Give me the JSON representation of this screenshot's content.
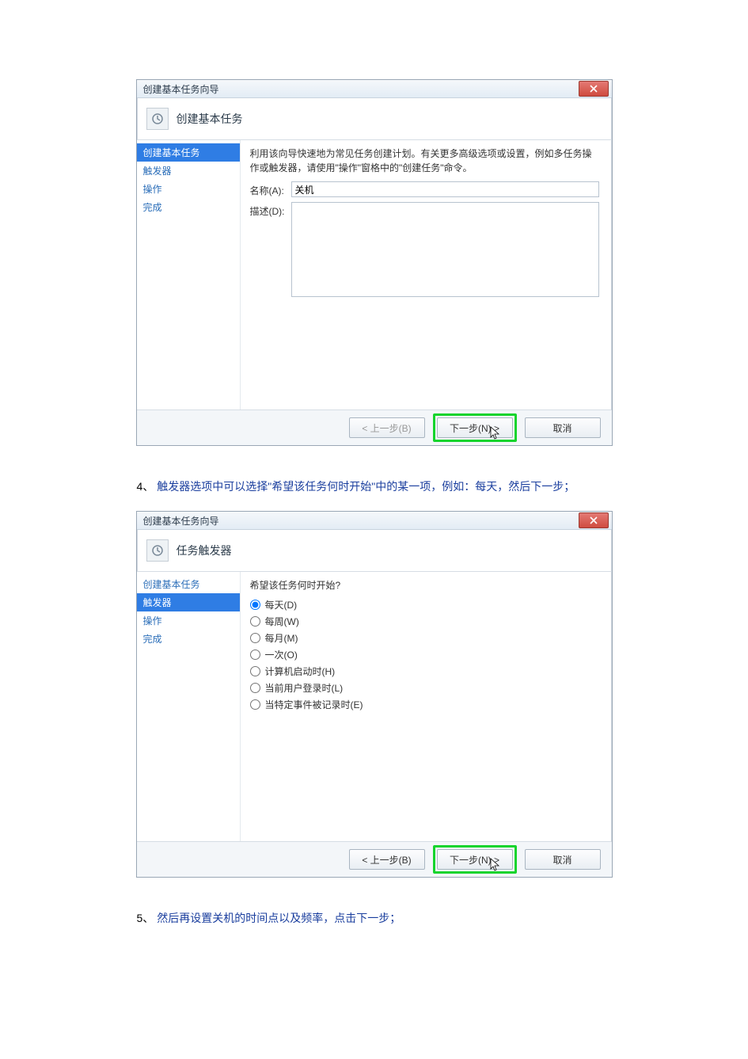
{
  "dialog1": {
    "title": "创建基本任务向导",
    "header": "创建基本任务",
    "sidebar": [
      "创建基本任务",
      "触发器",
      "操作",
      "完成"
    ],
    "selected_index": 0,
    "intro": "利用该向导快速地为常见任务创建计划。有关更多高级选项或设置，例如多任务操作或触发器，请使用\"操作\"窗格中的\"创建任务\"命令。",
    "name_label": "名称(A):",
    "name_value": "关机",
    "desc_label": "描述(D):",
    "desc_value": "",
    "buttons": {
      "back": "< 上一步(B)",
      "next": "下一步(N) >",
      "cancel": "取消"
    }
  },
  "step4": {
    "num": "4、",
    "text": "触发器选项中可以选择\"希望该任务何时开始\"中的某一项，例如：每天，然后下一步；"
  },
  "dialog2": {
    "title": "创建基本任务向导",
    "header": "任务触发器",
    "sidebar": [
      "创建基本任务",
      "触发器",
      "操作",
      "完成"
    ],
    "selected_index": 1,
    "question": "希望该任务何时开始?",
    "options": [
      "每天(D)",
      "每周(W)",
      "每月(M)",
      "一次(O)",
      "计算机启动时(H)",
      "当前用户登录时(L)",
      "当特定事件被记录时(E)"
    ],
    "selected_option": 0,
    "buttons": {
      "back": "< 上一步(B)",
      "next": "下一步(N) >",
      "cancel": "取消"
    }
  },
  "step5": {
    "num": "5、",
    "text": "然后再设置关机的时间点以及频率，点击下一步；"
  }
}
